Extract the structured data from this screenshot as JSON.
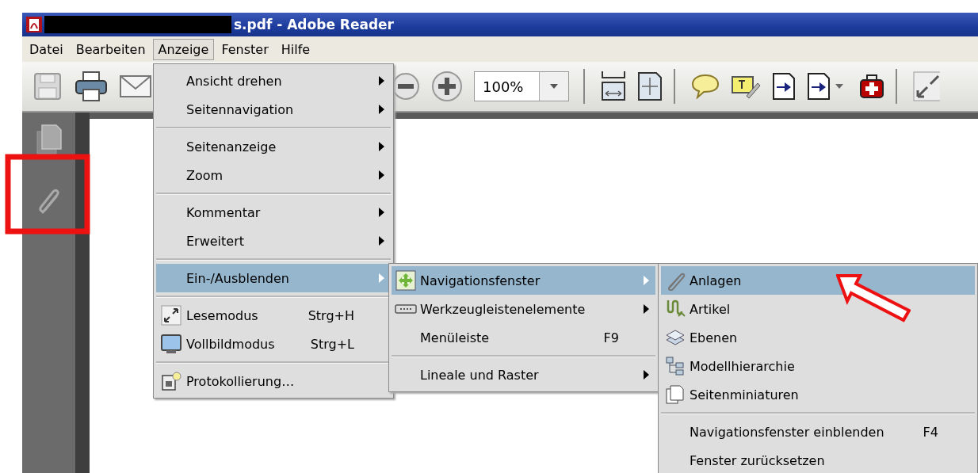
{
  "window": {
    "title": "s.pdf - Adobe Reader"
  },
  "menubar": [
    {
      "label": "Datei",
      "selected": false
    },
    {
      "label": "Bearbeiten",
      "selected": false
    },
    {
      "label": "Anzeige",
      "selected": true
    },
    {
      "label": "Fenster",
      "selected": false
    },
    {
      "label": "Hilfe",
      "selected": false
    }
  ],
  "toolbar": {
    "zoom": "100%"
  },
  "menus": [
    {
      "groups": [
        [
          {
            "label": "Ansicht drehen",
            "submenu": true,
            "selected": false
          },
          {
            "label": "Seitennavigation",
            "submenu": true,
            "selected": false
          }
        ],
        [
          {
            "label": "Seitenanzeige",
            "submenu": true,
            "selected": false
          },
          {
            "label": "Zoom",
            "submenu": true,
            "selected": false
          }
        ],
        [
          {
            "label": "Kommentar",
            "submenu": true,
            "selected": false
          },
          {
            "label": "Erweitert",
            "submenu": true,
            "selected": false
          }
        ],
        [
          {
            "label": "Ein-/Ausblenden",
            "submenu": true,
            "selected": true
          }
        ],
        [
          {
            "label": "Lesemodus",
            "shortcut": "Strg+H",
            "submenu": false,
            "selected": false
          },
          {
            "label": "Vollbildmodus",
            "shortcut": "Strg+L",
            "submenu": false,
            "selected": false
          }
        ],
        [
          {
            "label": "Protokollierung…",
            "submenu": false,
            "selected": false
          }
        ]
      ]
    },
    {
      "groups": [
        [
          {
            "label": "Navigationsfenster",
            "submenu": true,
            "selected": true
          },
          {
            "label": "Werkzeugleistenelemente",
            "submenu": true,
            "selected": false
          },
          {
            "label": "Menüleiste",
            "shortcut": "F9",
            "submenu": false,
            "selected": false
          }
        ],
        [
          {
            "label": "Lineale und Raster",
            "submenu": true,
            "selected": false
          }
        ]
      ]
    },
    {
      "groups": [
        [
          {
            "label": "Anlagen",
            "submenu": false,
            "selected": true
          },
          {
            "label": "Artikel",
            "submenu": false,
            "selected": false
          },
          {
            "label": "Ebenen",
            "submenu": false,
            "selected": false
          },
          {
            "label": "Modellhierarchie",
            "submenu": false,
            "selected": false
          },
          {
            "label": "Seitenminiaturen",
            "submenu": false,
            "selected": false
          }
        ],
        [
          {
            "label": "Navigationsfenster einblenden",
            "shortcut": "F4",
            "submenu": false,
            "selected": false
          },
          {
            "label": "Fenster zurücksetzen",
            "submenu": false,
            "selected": false
          }
        ]
      ]
    }
  ]
}
